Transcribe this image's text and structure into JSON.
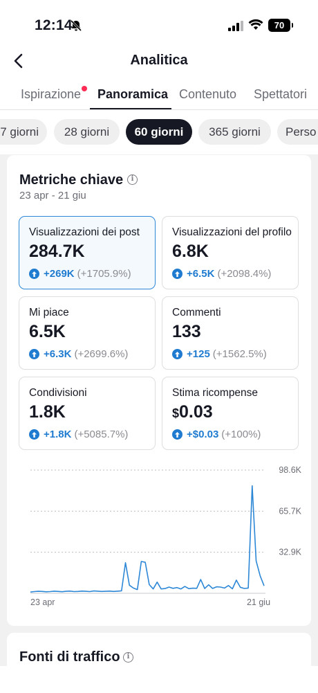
{
  "status_bar": {
    "time": "12:14",
    "battery": "70"
  },
  "header": {
    "title": "Analitica"
  },
  "tabs": [
    {
      "label": "Ispirazione"
    },
    {
      "label": "Panoramica"
    },
    {
      "label": "Contenuto"
    },
    {
      "label": "Spettatori"
    }
  ],
  "periods": [
    {
      "label": "7 giorni"
    },
    {
      "label": "28 giorni"
    },
    {
      "label": "60 giorni"
    },
    {
      "label": "365 giorni"
    },
    {
      "label": "Perso"
    }
  ],
  "key_metrics": {
    "title": "Metriche chiave",
    "date_range": "23 apr - 21 giu",
    "cards": [
      {
        "label": "Visualizzazioni dei post",
        "value": "284.7K",
        "delta": "+269K",
        "delta_pct": "(+1705.9%)"
      },
      {
        "label": "Visualizzazioni del profilo",
        "value": "6.8K",
        "delta": "+6.5K",
        "delta_pct": "(+2098.4%)"
      },
      {
        "label": "Mi piace",
        "value": "6.5K",
        "delta": "+6.3K",
        "delta_pct": "(+2699.6%)"
      },
      {
        "label": "Commenti",
        "value": "133",
        "delta": "+125",
        "delta_pct": "(+1562.5%)"
      },
      {
        "label": "Condivisioni",
        "value": "1.8K",
        "delta": "+1.8K",
        "delta_pct": "(+5085.7%)"
      },
      {
        "label": "Stima ricompense",
        "currency": "$",
        "value": "0.03",
        "delta": "+$0.03",
        "delta_pct": "(+100%)"
      }
    ]
  },
  "chart_data": {
    "type": "line",
    "x_start_label": "23 apr",
    "x_end_label": "21 giu",
    "y_ticks": [
      32.9,
      65.7,
      98.6
    ],
    "y_tick_labels": [
      "32.9K",
      "65.7K",
      "98.6K"
    ],
    "ylim": [
      0,
      98.6
    ],
    "grid": true,
    "series": [
      {
        "color": "#2c87d6",
        "values": [
          1.0,
          1.4,
          1.6,
          1.5,
          1.2,
          1.4,
          1.7,
          1.5,
          1.3,
          1.6,
          1.8,
          1.4,
          1.5,
          1.8,
          1.6,
          1.4,
          1.9,
          1.7,
          1.5,
          1.6,
          1.8,
          1.5,
          1.7,
          2.0,
          24.5,
          6.5,
          4.2,
          3.0,
          25.5,
          24.8,
          7.0,
          3.5,
          9.0,
          3.5,
          3.8,
          5.0,
          4.0,
          4.6,
          3.5,
          5.5,
          3.7,
          4.1,
          4.0,
          11.0,
          3.8,
          6.8,
          3.9,
          5.2,
          5.0,
          4.2,
          6.2,
          3.6,
          10.5,
          4.8,
          3.9,
          4.2,
          86.0,
          26.0,
          14.0,
          6.0
        ]
      }
    ]
  },
  "traffic_sources": {
    "title": "Fonti di traffico"
  },
  "colors": {
    "accent": "#2c87d6",
    "tab_dot": "#fe2c55",
    "active_pill": "#161823"
  }
}
